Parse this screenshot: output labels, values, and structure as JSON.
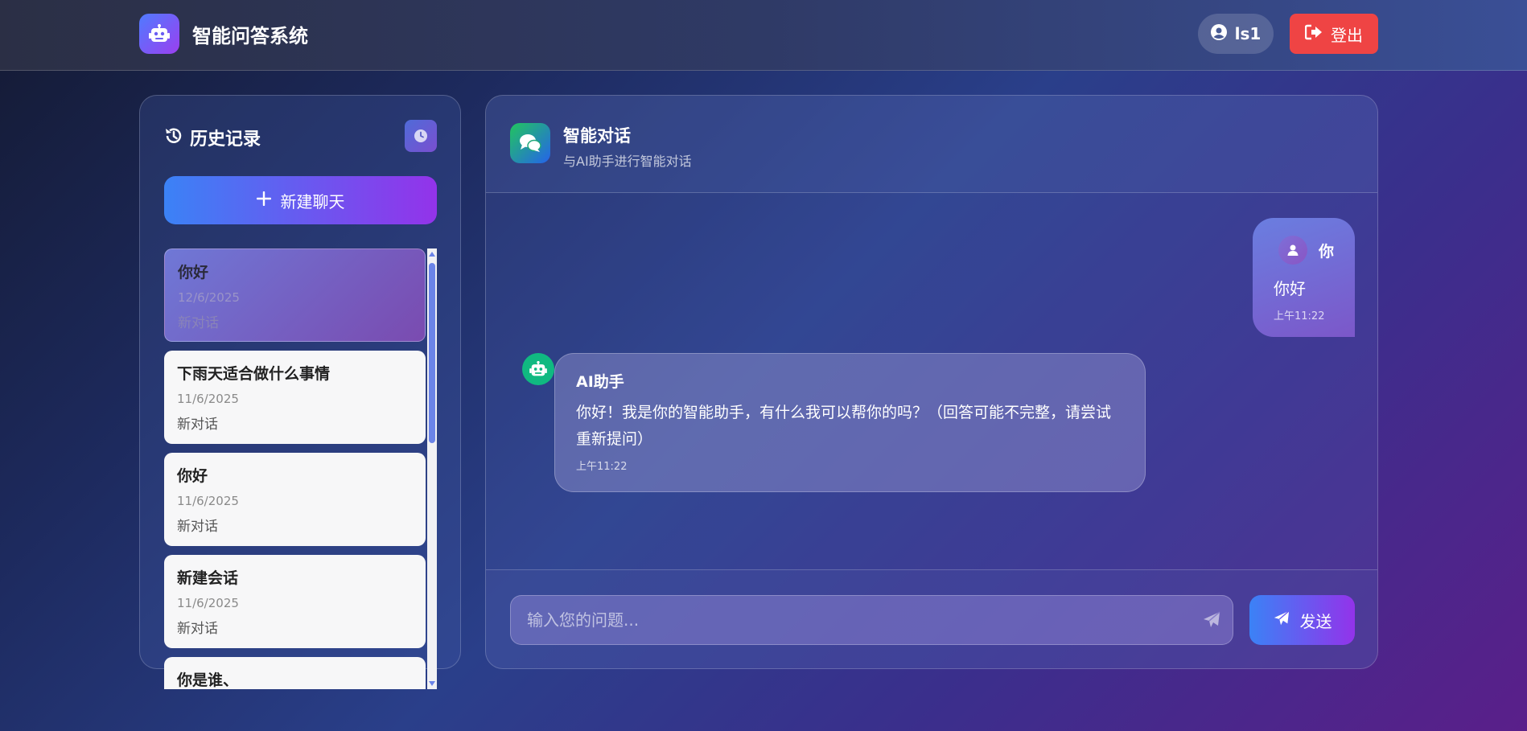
{
  "app": {
    "title": "智能问答系统",
    "username": "ls1",
    "logout_label": "登出"
  },
  "sidebar": {
    "title": "历史记录",
    "new_chat_label": "新建聊天",
    "items": [
      {
        "title": "你好",
        "date": "12/6/2025",
        "subtitle": "新对话",
        "active": true
      },
      {
        "title": "下雨天适合做什么事情",
        "date": "11/6/2025",
        "subtitle": "新对话"
      },
      {
        "title": "你好",
        "date": "11/6/2025",
        "subtitle": "新对话"
      },
      {
        "title": "新建会话",
        "date": "11/6/2025",
        "subtitle": "新对话"
      },
      {
        "title": "你是谁、",
        "date": "",
        "subtitle": ""
      }
    ]
  },
  "chat": {
    "title": "智能对话",
    "subtitle": "与AI助手进行智能对话",
    "messages": [
      {
        "role": "user",
        "name": "你",
        "text": "你好",
        "time": "上午11:22"
      },
      {
        "role": "assistant",
        "name": "AI助手",
        "text": "你好！我是你的智能助手，有什么我可以帮你的吗？（回答可能不完整，请尝试重新提问）",
        "time": "上午11:22"
      }
    ],
    "input_placeholder": "输入您的问题...",
    "send_label": "发送"
  },
  "colors": {
    "logout": "#ef4444",
    "accent_start": "#3b82f6",
    "accent_end": "#9333ea",
    "bot_avatar": "#10b981"
  },
  "icons": {
    "brand": "robot-icon",
    "user": "user-circle-icon",
    "logout": "sign-out-icon",
    "history": "history-icon",
    "clock": "clock-icon",
    "new_chat": "plus-icon",
    "chat": "comments-icon",
    "send": "paper-plane-icon"
  }
}
